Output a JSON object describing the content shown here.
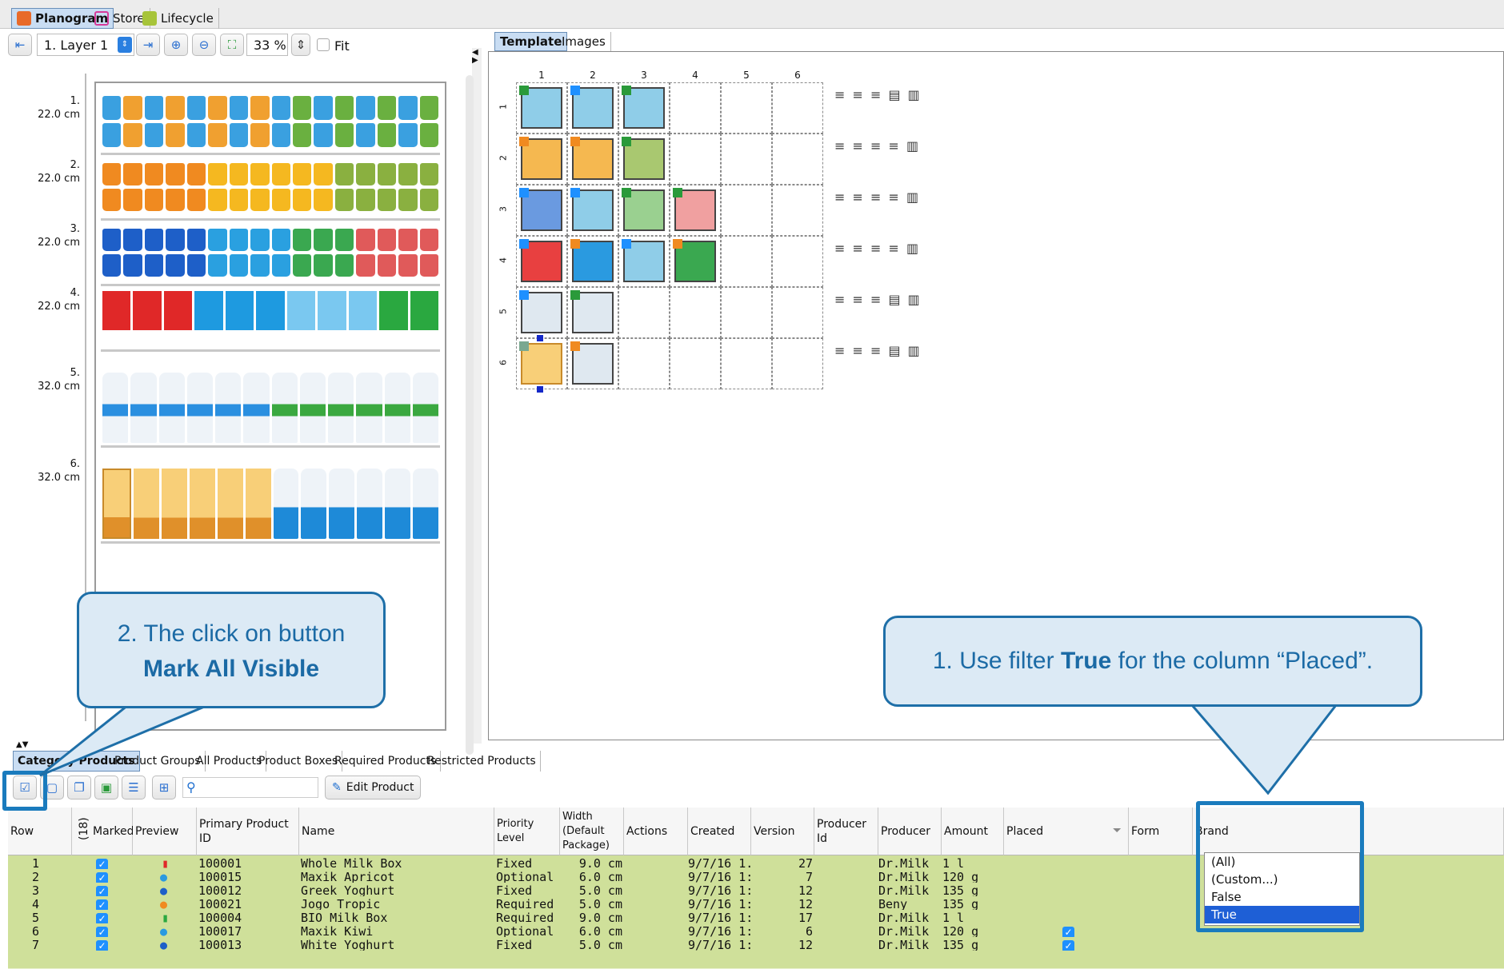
{
  "top_tabs": [
    {
      "label": "Planogram",
      "icon": "planogram-icon"
    },
    {
      "label": "Store",
      "icon": "store-icon"
    },
    {
      "label": "Lifecycle",
      "icon": "lifecycle-icon"
    }
  ],
  "toolbar": {
    "layer_value": "1. Layer 1",
    "zoom_value": "33 %",
    "fit_label": "Fit"
  },
  "planogram_rows": [
    {
      "num": "1.",
      "height": "22.0 cm"
    },
    {
      "num": "2.",
      "height": "22.0 cm"
    },
    {
      "num": "3.",
      "height": "22.0 cm"
    },
    {
      "num": "4.",
      "height": "22.0 cm"
    },
    {
      "num": "5.",
      "height": "32.0 cm"
    },
    {
      "num": "6.",
      "height": "32.0 cm"
    }
  ],
  "right_tabs": [
    "Template",
    "Images"
  ],
  "template": {
    "columns": [
      "1",
      "2",
      "3",
      "4",
      "5",
      "6"
    ],
    "rows": [
      "1",
      "2",
      "3",
      "4",
      "5",
      "6"
    ]
  },
  "bottom_tabs": [
    "Category Products",
    "Product Groups",
    "All Products",
    "Product Boxes",
    "Required Products",
    "Restricted Products"
  ],
  "bottom_toolbar": {
    "edit_product_label": "Edit Product",
    "search_placeholder": ""
  },
  "table": {
    "count_label": "(18)",
    "headers": [
      "Row",
      "Marked",
      "Preview",
      "Primary Product ID",
      "Name",
      "Priority Level",
      "Width (Default Package)",
      "Actions",
      "Created",
      "Version",
      "Producer Id",
      "Producer",
      "Amount",
      "Placed",
      "Form",
      "Brand"
    ],
    "rows": [
      {
        "row": "1",
        "id": "100001",
        "name": "Whole Milk Box",
        "priority": "Fixed",
        "width": "9.0 cm",
        "created": "9/7/16 1...",
        "version": "27",
        "producer": "Dr.Milk",
        "amount": "1 l"
      },
      {
        "row": "2",
        "id": "100015",
        "name": "Maxik Apricot",
        "priority": "Optional",
        "width": "6.0 cm",
        "created": "9/7/16 1:...",
        "version": "7",
        "producer": "Dr.Milk",
        "amount": "120 g"
      },
      {
        "row": "3",
        "id": "100012",
        "name": "Greek Yoghurt",
        "priority": "Fixed",
        "width": "5.0 cm",
        "created": "9/7/16 1:...",
        "version": "12",
        "producer": "Dr.Milk",
        "amount": "135 g"
      },
      {
        "row": "4",
        "id": "100021",
        "name": "Jogo Tropic",
        "priority": "Required",
        "width": "5.0 cm",
        "created": "9/7/16 1:...",
        "version": "12",
        "producer": "Beny",
        "amount": "135 g"
      },
      {
        "row": "5",
        "id": "100004",
        "name": "BIO Milk Box",
        "priority": "Required",
        "width": "9.0 cm",
        "created": "9/7/16 1:...",
        "version": "17",
        "producer": "Dr.Milk",
        "amount": "1 l"
      },
      {
        "row": "6",
        "id": "100017",
        "name": "Maxik Kiwi",
        "priority": "Optional",
        "width": "6.0 cm",
        "created": "9/7/16 1:...",
        "version": "6",
        "producer": "Dr.Milk",
        "amount": "120 g"
      },
      {
        "row": "7",
        "id": "100013",
        "name": "White Yoghurt",
        "priority": "Fixed",
        "width": "5.0 cm",
        "created": "9/7/16 1:...",
        "version": "12",
        "producer": "Dr.Milk",
        "amount": "135 g"
      }
    ]
  },
  "filter_dropdown": {
    "options": [
      "(All)",
      "(Custom...)",
      "False",
      "True"
    ],
    "selected": "True"
  },
  "callouts": {
    "left_line1": "2. The click on button",
    "left_line2": "Mark All Visible",
    "right_prefix": "1. Use filter ",
    "right_bold": "True",
    "right_suffix": " for the column “Placed”."
  },
  "colors": {
    "accent": "#1e6fa8",
    "row_green": "#cfe09a",
    "selected_tab": "#c9ddf3"
  }
}
